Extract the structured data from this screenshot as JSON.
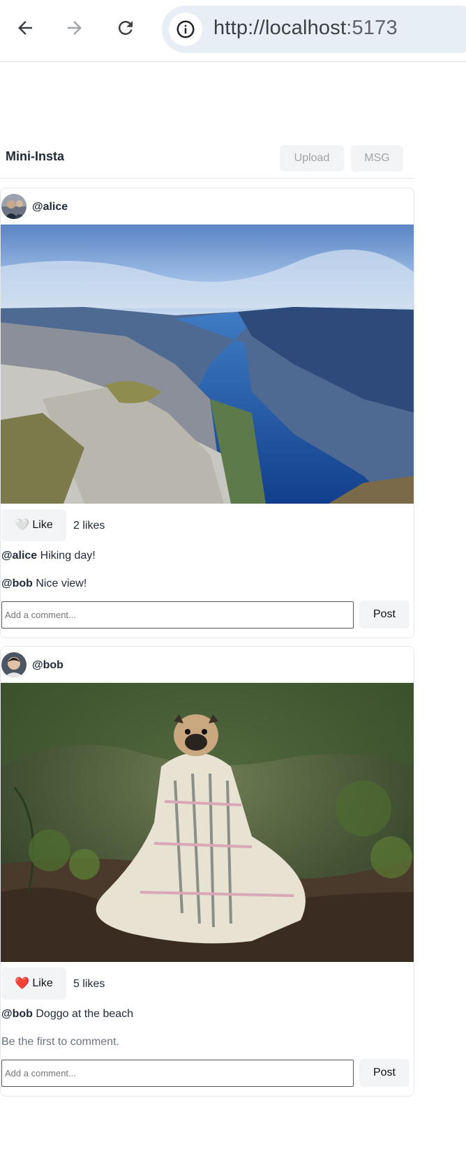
{
  "browser": {
    "url_host": "http://localhost",
    "url_port": ":5173"
  },
  "app": {
    "brand": "Mini-Insta",
    "upload_label": "Upload",
    "msg_label": "MSG"
  },
  "posts": [
    {
      "username": "@alice",
      "like_icon": "🤍",
      "like_label": "Like",
      "likes": "2 likes",
      "caption_user": "@alice",
      "caption_text": " Hiking day!",
      "comments": [
        {
          "user": "@bob",
          "text": " Nice view!"
        }
      ],
      "comment_placeholder": "Add a comment...",
      "post_label": "Post"
    },
    {
      "username": "@bob",
      "like_icon": "❤️",
      "like_label": "Like",
      "likes": "5 likes",
      "caption_user": "@bob",
      "caption_text": " Doggo at the beach",
      "empty_comments": "Be the first to comment.",
      "comment_placeholder": "Add a comment...",
      "post_label": "Post"
    }
  ]
}
